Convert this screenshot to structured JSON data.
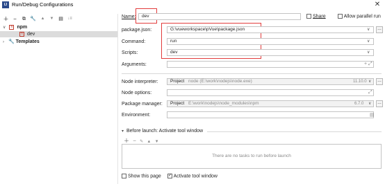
{
  "window": {
    "title": "Run/Debug Configurations",
    "app_icon_text": "IJ"
  },
  "toolbar": {
    "icons": [
      "add-icon",
      "remove-icon",
      "copy-icon",
      "wrench-icon",
      "move-up-icon",
      "move-down-icon",
      "folder-icon",
      "sort-icon"
    ]
  },
  "tree": {
    "npm_label": "npm",
    "dev_label": "dev",
    "templates_label": "Templates"
  },
  "form": {
    "name_label": "Name:",
    "name_value": "dev",
    "share_label": "Share",
    "allow_parallel_label": "Allow parallel run",
    "package_json_label": "package.json:",
    "package_json_value": "G:\\vueworkspace\\pVue\\package.json",
    "command_label": "Command:",
    "command_value": "run",
    "scripts_label": "Scripts:",
    "scripts_value": "dev",
    "arguments_label": "Arguments:",
    "arguments_value": "",
    "node_interpreter_label": "Node interpreter:",
    "node_interpreter_prefix": "Project",
    "node_interpreter_value": "node (E:\\work\\nodejs\\node.exe)",
    "node_interpreter_version": "11.10.0",
    "node_options_label": "Node options:",
    "node_options_value": "",
    "package_manager_label": "Package manager:",
    "package_manager_prefix": "Project",
    "package_manager_value": "E:\\work\\nodejs\\node_modules\\npm",
    "package_manager_version": "6.7.0",
    "environment_label": "Environment:",
    "environment_value": ""
  },
  "before_launch": {
    "header": "Before launch: Activate tool window",
    "empty_text": "There are no tasks to run before launch",
    "show_page_label": "Show this page",
    "activate_tool_label": "Activate tool window",
    "activate_tool_checked": true,
    "show_page_checked": false
  },
  "colors": {
    "highlight": "#e23b3b",
    "npm_red": "#c0392b",
    "selection": "#dcdcdc"
  }
}
